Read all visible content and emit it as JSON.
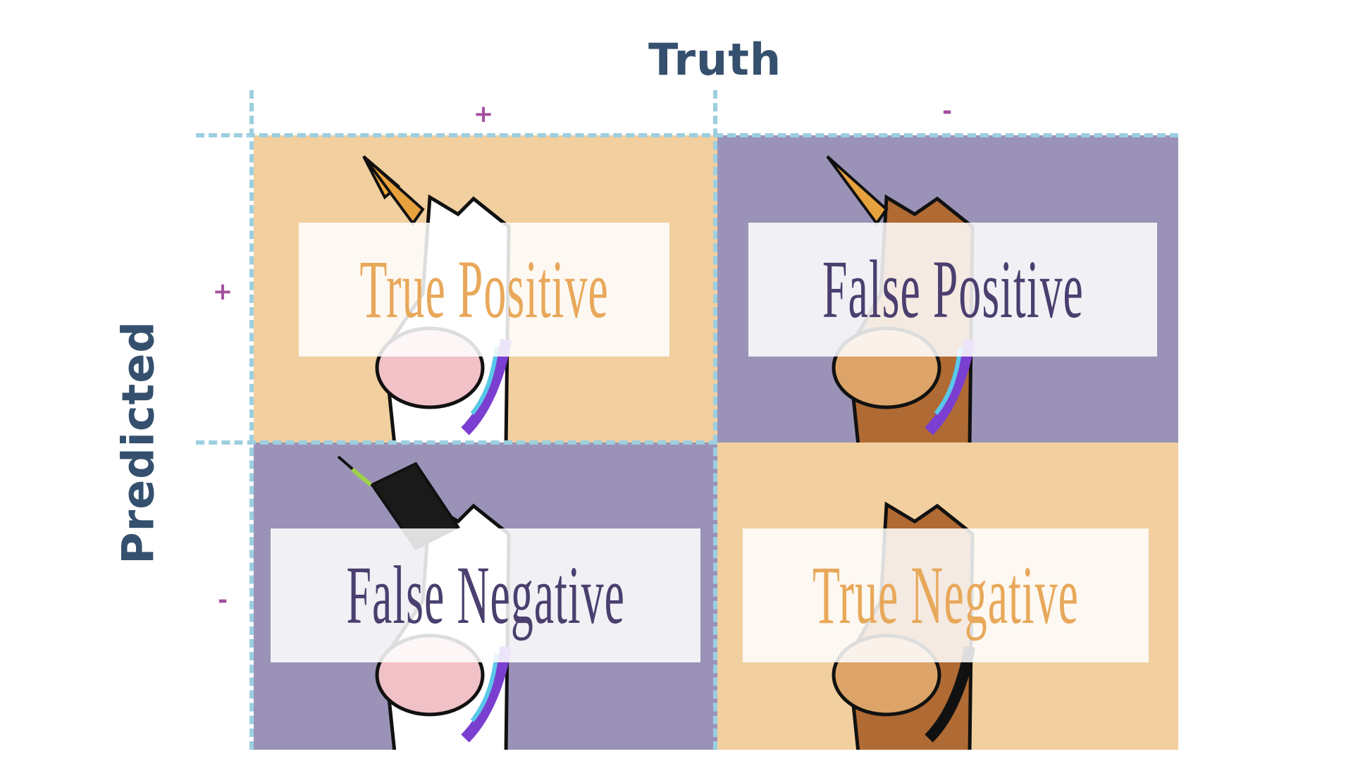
{
  "axes": {
    "truth_title": "Truth",
    "predicted_title": "Predicted",
    "truth_positive": "+",
    "truth_negative": "-",
    "predicted_positive": "+",
    "predicted_negative": "-"
  },
  "cells": {
    "tp": {
      "label": "True Positive",
      "background": "#f2cf9f",
      "text_color": "#e8a85a",
      "icon": "unicorn-head-icon"
    },
    "fp": {
      "label": "False Positive",
      "background": "#9b92b8",
      "text_color": "#4a3f6e",
      "icon": "horse-with-fake-horn-icon"
    },
    "fn": {
      "label": "False Negative",
      "background": "#9b92b8",
      "text_color": "#4a3f6e",
      "icon": "unicorn-with-broken-horn-icon"
    },
    "tn": {
      "label": "True Negative",
      "background": "#f2cf9f",
      "text_color": "#e8a85a",
      "icon": "horse-head-icon"
    }
  },
  "colors": {
    "axis_title": "#34506e",
    "sign": "#a4509e",
    "grid_dash": "#9ccfe0"
  }
}
